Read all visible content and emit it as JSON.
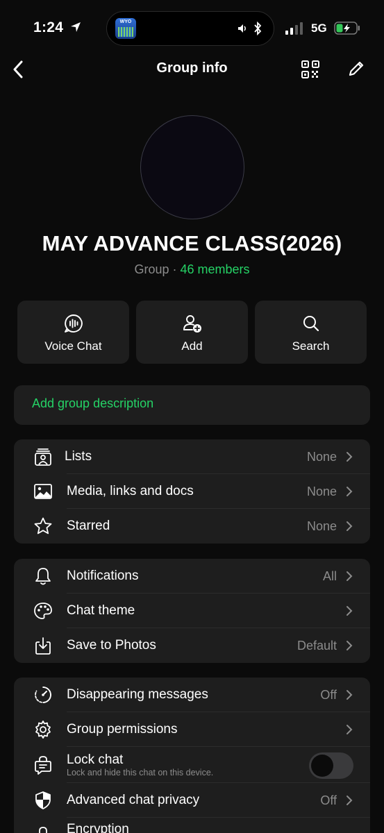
{
  "status_bar": {
    "time": "1:24",
    "island_app_label": "WYO",
    "network": "5G"
  },
  "nav": {
    "title": "Group info"
  },
  "group": {
    "name": "MAY ADVANCE CLASS(2026)",
    "type_label": "Group",
    "separator": " · ",
    "members_label": "46 members"
  },
  "actions": [
    {
      "label": "Voice Chat",
      "icon": "voice-chat-icon"
    },
    {
      "label": "Add",
      "icon": "add-person-icon"
    },
    {
      "label": "Search",
      "icon": "search-icon"
    }
  ],
  "description": {
    "placeholder": "Add group description"
  },
  "section1": [
    {
      "label": "Lists",
      "value": "None",
      "icon": "lists-icon"
    },
    {
      "label": "Media, links and docs",
      "value": "None",
      "icon": "photo-icon"
    },
    {
      "label": "Starred",
      "value": "None",
      "icon": "star-icon"
    }
  ],
  "section2": [
    {
      "label": "Notifications",
      "value": "All",
      "icon": "bell-icon"
    },
    {
      "label": "Chat theme",
      "value": "",
      "icon": "palette-icon"
    },
    {
      "label": "Save to Photos",
      "value": "Default",
      "icon": "save-download-icon"
    }
  ],
  "section3": [
    {
      "label": "Disappearing messages",
      "value": "Off",
      "icon": "timer-icon"
    },
    {
      "label": "Group permissions",
      "value": "",
      "icon": "gear-icon"
    },
    {
      "label": "Lock chat",
      "sublabel": "Lock and hide this chat on this device.",
      "toggle_on": false,
      "icon": "lock-chat-icon"
    },
    {
      "label": "Advanced chat privacy",
      "value": "Off",
      "icon": "shield-icon"
    },
    {
      "label": "Encryption",
      "icon": "encryption-icon"
    }
  ],
  "colors": {
    "background": "#0b0b0b",
    "card": "#1e1e1e",
    "accent_green": "#25d366",
    "secondary_text": "#8c8c8c"
  }
}
